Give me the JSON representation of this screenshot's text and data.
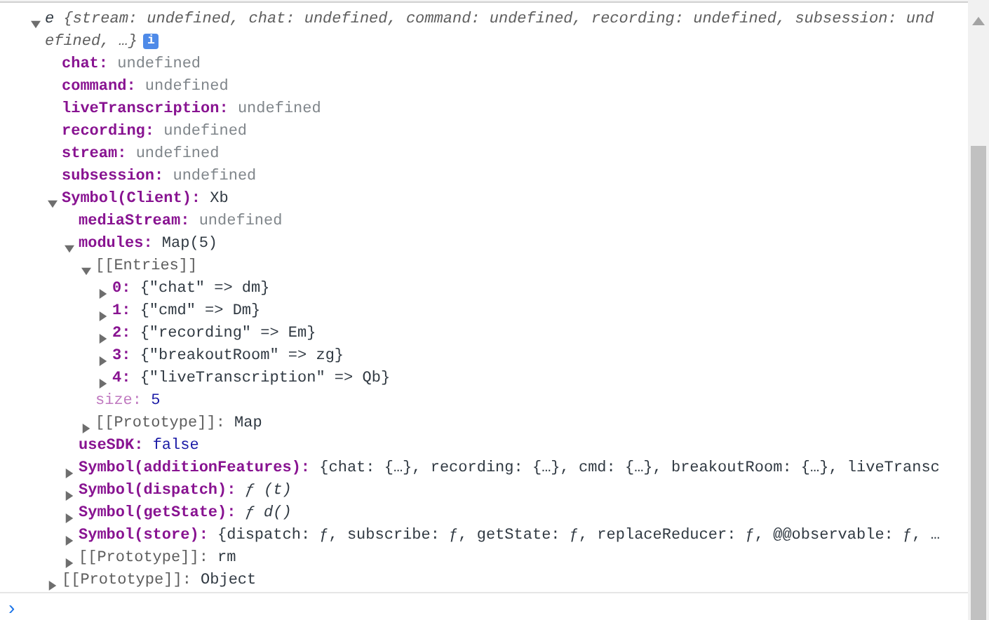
{
  "root": {
    "name": "e",
    "preview_lines": [
      "{stream: undefined, chat: undefined, command: undefined, recording: undefined, subsession: und",
      "efined, …}"
    ],
    "expanded": true,
    "info_badge": "i",
    "children": [
      {
        "name": "chat:",
        "kind": "unset",
        "value": "undefined"
      },
      {
        "name": "command:",
        "kind": "unset",
        "value": "undefined"
      },
      {
        "name": "liveTranscription:",
        "kind": "unset",
        "value": "undefined"
      },
      {
        "name": "recording:",
        "kind": "unset",
        "value": "undefined"
      },
      {
        "name": "stream:",
        "kind": "unset",
        "value": "undefined"
      },
      {
        "name": "subsession:",
        "kind": "unset",
        "value": "undefined"
      },
      {
        "name": "Symbol(Client):",
        "kind": "object",
        "value": "Xb",
        "expanded": true,
        "children": [
          {
            "name": "mediaStream:",
            "kind": "unset",
            "value": "undefined"
          },
          {
            "name": "modules:",
            "kind": "object",
            "value": "Map(5)",
            "expanded": true,
            "children": [
              {
                "name": "[[Entries]]",
                "kind": "internal",
                "expanded": true,
                "children": [
                  {
                    "name": "0:",
                    "kind": "object",
                    "value": "{\"chat\" => dm}",
                    "expanded": false
                  },
                  {
                    "name": "1:",
                    "kind": "object",
                    "value": "{\"cmd\" => Dm}",
                    "expanded": false
                  },
                  {
                    "name": "2:",
                    "kind": "object",
                    "value": "{\"recording\" => Em}",
                    "expanded": false
                  },
                  {
                    "name": "3:",
                    "kind": "object",
                    "value": "{\"breakoutRoom\" => zg}",
                    "expanded": false
                  },
                  {
                    "name": "4:",
                    "kind": "object",
                    "value": "{\"liveTranscription\" => Qb}",
                    "expanded": false
                  }
                ]
              },
              {
                "name": "size:",
                "kind": "synthetic",
                "value": "5"
              },
              {
                "name": "[[Prototype]]:",
                "kind": "internal",
                "value": "Map",
                "expanded": false
              }
            ]
          },
          {
            "name": "useSDK:",
            "kind": "primitive",
            "value": "false"
          },
          {
            "name": "Symbol(additionFeatures):",
            "kind": "object",
            "value": "{chat: {…}, recording: {…}, cmd: {…}, breakoutRoom: {…}, liveTransc",
            "expanded": false
          },
          {
            "name": "Symbol(dispatch):",
            "kind": "function",
            "value": "ƒ (t)",
            "expanded": false
          },
          {
            "name": "Symbol(getState):",
            "kind": "function",
            "value": "ƒ d()",
            "expanded": false
          },
          {
            "name": "Symbol(store):",
            "kind": "object",
            "value": "{dispatch: ƒ, subscribe: ƒ, getState: ƒ, replaceReducer: ƒ, @@observable: ƒ, …",
            "expanded": false
          },
          {
            "name": "[[Prototype]]:",
            "kind": "internal",
            "value": "rm",
            "expanded": false
          }
        ]
      },
      {
        "name": "[[Prototype]]:",
        "kind": "internal",
        "value": "Object",
        "expanded": false
      }
    ]
  },
  "prompt": "›"
}
